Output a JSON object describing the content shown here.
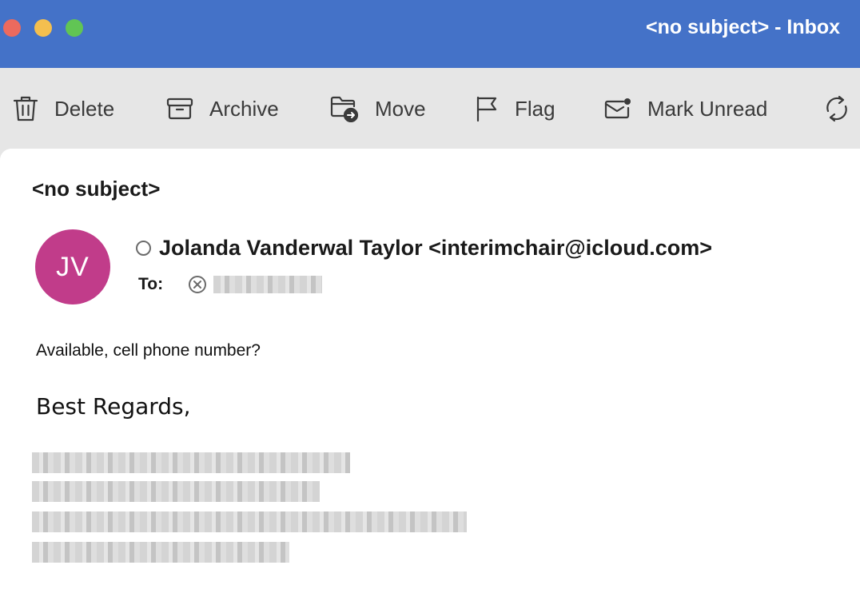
{
  "window": {
    "title": "<no subject> - Inbox",
    "colors": {
      "titlebar": "#4472c8",
      "toolbar": "#e6e6e6",
      "avatar": "#c13c8a",
      "close": "#ec6a5e",
      "minimize": "#f4bf4f",
      "maximize": "#61c554"
    }
  },
  "toolbar": {
    "delete_label": "Delete",
    "archive_label": "Archive",
    "move_label": "Move",
    "flag_label": "Flag",
    "mark_unread_label": "Mark Unread",
    "icons": [
      "trash-icon",
      "archive-icon",
      "move-folder-icon",
      "flag-icon",
      "mail-unread-icon",
      "sync-icon"
    ]
  },
  "message": {
    "subject": "<no subject>",
    "avatar_initials": "JV",
    "sender": "Jolanda Vanderwal Taylor <interimchair@icloud.com>",
    "to_label": "To:",
    "body": "Available, cell phone number?",
    "closing": "Best Regards,"
  }
}
